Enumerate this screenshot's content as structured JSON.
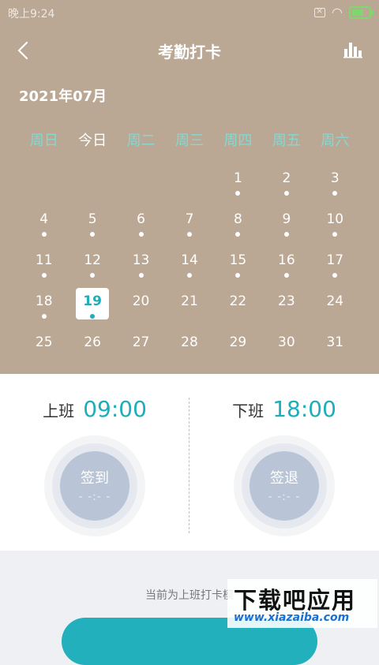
{
  "status_bar": {
    "time": "晚上9:24",
    "sim_icon": "sim-off-icon",
    "wifi_icon": "wifi-icon",
    "battery_icon": "battery-charging-icon"
  },
  "header": {
    "title": "考勤打卡",
    "back_icon": "back-chevron-icon",
    "stats_icon": "bar-chart-icon"
  },
  "calendar": {
    "month": "2021年07月",
    "weekdays": [
      "周日",
      "今日",
      "周二",
      "周三",
      "周四",
      "周五",
      "周六"
    ],
    "leading_blank_days": 4,
    "days": [
      {
        "day": "1",
        "dot": true
      },
      {
        "day": "2",
        "dot": true
      },
      {
        "day": "3",
        "dot": true
      },
      {
        "day": "4",
        "dot": true
      },
      {
        "day": "5",
        "dot": true
      },
      {
        "day": "6",
        "dot": true
      },
      {
        "day": "7",
        "dot": true
      },
      {
        "day": "8",
        "dot": true
      },
      {
        "day": "9",
        "dot": true
      },
      {
        "day": "10",
        "dot": true
      },
      {
        "day": "11",
        "dot": true
      },
      {
        "day": "12",
        "dot": true
      },
      {
        "day": "13",
        "dot": true
      },
      {
        "day": "14",
        "dot": true
      },
      {
        "day": "15",
        "dot": true
      },
      {
        "day": "16",
        "dot": true
      },
      {
        "day": "17",
        "dot": true
      },
      {
        "day": "18",
        "dot": true
      },
      {
        "day": "19",
        "dot": true,
        "selected": true
      },
      {
        "day": "20",
        "dot": false
      },
      {
        "day": "21",
        "dot": false
      },
      {
        "day": "22",
        "dot": false
      },
      {
        "day": "23",
        "dot": false
      },
      {
        "day": "24",
        "dot": false
      },
      {
        "day": "25",
        "dot": false
      },
      {
        "day": "26",
        "dot": false
      },
      {
        "day": "27",
        "dot": false
      },
      {
        "day": "28",
        "dot": false
      },
      {
        "day": "29",
        "dot": false
      },
      {
        "day": "30",
        "dot": false
      },
      {
        "day": "31",
        "dot": false
      }
    ]
  },
  "checkin": {
    "on_duty": {
      "label": "上班",
      "time": "09:00",
      "action": "签到",
      "placeholder": "- -:- -"
    },
    "off_duty": {
      "label": "下班",
      "time": "18:00",
      "action": "签退",
      "placeholder": "- -:- -"
    }
  },
  "notice": "当前为上班打卡模",
  "watermark": {
    "main": "下载吧应用",
    "sub": "www.xiazaiba.com"
  },
  "colors": {
    "header_bg": "#baa794",
    "accent": "#1faeb9",
    "weekday": "#86d8d1",
    "ring": "#b9c5d6"
  }
}
